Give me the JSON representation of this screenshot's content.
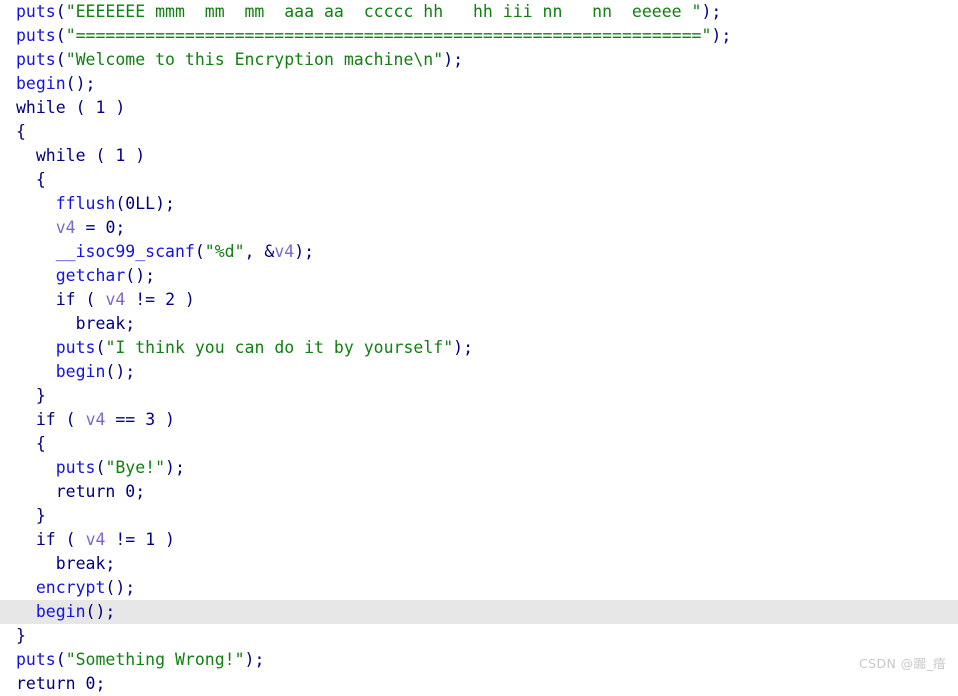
{
  "editor": {
    "kind": "decompiler-pseudocode-view",
    "background_color": "#ffffff",
    "highlight_color": "#e7e7e7",
    "token_colors": {
      "keyword": "#000080",
      "function": "#1414e0",
      "string": "#108010",
      "variable": "#7b68c8",
      "punctuation": "#000080",
      "number": "#000080"
    },
    "highlighted_line_index": 24
  },
  "watermark": {
    "text": "CSDN @嚻_瘖",
    "color": "#c8c8c8"
  },
  "code": {
    "lines": [
      {
        "indent": 0,
        "highlighted": false,
        "text": "puts(\"EEEEEEE mmm  mm  mm  aaa aa  ccccc hh   hh iii nn   nn  eeeee \");",
        "tokens": [
          {
            "c": "fn",
            "t": "puts"
          },
          {
            "c": "punct",
            "t": "("
          },
          {
            "c": "str",
            "t": "\"EEEEEEE mmm  mm  mm  aaa aa  ccccc hh   hh iii nn   nn  eeeee \""
          },
          {
            "c": "punct",
            "t": ")"
          },
          {
            "c": "plain",
            "t": ";"
          }
        ]
      },
      {
        "indent": 0,
        "highlighted": false,
        "text": "puts(\"===============================================================\");",
        "tokens": [
          {
            "c": "fn",
            "t": "puts"
          },
          {
            "c": "punct",
            "t": "("
          },
          {
            "c": "str",
            "t": "\"===============================================================\""
          },
          {
            "c": "punct",
            "t": ")"
          },
          {
            "c": "plain",
            "t": ";"
          }
        ]
      },
      {
        "indent": 0,
        "highlighted": false,
        "text": "puts(\"Welcome to this Encryption machine\\n\");",
        "tokens": [
          {
            "c": "fn",
            "t": "puts"
          },
          {
            "c": "punct",
            "t": "("
          },
          {
            "c": "str",
            "t": "\"Welcome to this Encryption machine\\n\""
          },
          {
            "c": "punct",
            "t": ")"
          },
          {
            "c": "plain",
            "t": ";"
          }
        ]
      },
      {
        "indent": 0,
        "highlighted": false,
        "text": "begin();",
        "tokens": [
          {
            "c": "fn",
            "t": "begin"
          },
          {
            "c": "punct",
            "t": "()"
          },
          {
            "c": "plain",
            "t": ";"
          }
        ]
      },
      {
        "indent": 0,
        "highlighted": false,
        "text": "while ( 1 )",
        "tokens": [
          {
            "c": "kw",
            "t": "while"
          },
          {
            "c": "plain",
            "t": " ( "
          },
          {
            "c": "num",
            "t": "1"
          },
          {
            "c": "plain",
            "t": " )"
          }
        ]
      },
      {
        "indent": 0,
        "highlighted": false,
        "text": "{",
        "tokens": [
          {
            "c": "punct",
            "t": "{"
          }
        ]
      },
      {
        "indent": 1,
        "highlighted": false,
        "text": "while ( 1 )",
        "tokens": [
          {
            "c": "kw",
            "t": "while"
          },
          {
            "c": "plain",
            "t": " ( "
          },
          {
            "c": "num",
            "t": "1"
          },
          {
            "c": "plain",
            "t": " )"
          }
        ]
      },
      {
        "indent": 1,
        "highlighted": false,
        "text": "{",
        "tokens": [
          {
            "c": "punct",
            "t": "{"
          }
        ]
      },
      {
        "indent": 2,
        "highlighted": false,
        "text": "fflush(0LL);",
        "tokens": [
          {
            "c": "fn",
            "t": "fflush"
          },
          {
            "c": "punct",
            "t": "("
          },
          {
            "c": "num",
            "t": "0LL"
          },
          {
            "c": "punct",
            "t": ")"
          },
          {
            "c": "plain",
            "t": ";"
          }
        ]
      },
      {
        "indent": 2,
        "highlighted": false,
        "text": "v4 = 0;",
        "tokens": [
          {
            "c": "var",
            "t": "v4"
          },
          {
            "c": "plain",
            "t": " = "
          },
          {
            "c": "num",
            "t": "0"
          },
          {
            "c": "plain",
            "t": ";"
          }
        ]
      },
      {
        "indent": 2,
        "highlighted": false,
        "text": "__isoc99_scanf(\"%d\", &v4);",
        "tokens": [
          {
            "c": "fn",
            "t": "__isoc99_scanf"
          },
          {
            "c": "punct",
            "t": "("
          },
          {
            "c": "str",
            "t": "\"%d\""
          },
          {
            "c": "plain",
            "t": ", &"
          },
          {
            "c": "var",
            "t": "v4"
          },
          {
            "c": "punct",
            "t": ")"
          },
          {
            "c": "plain",
            "t": ";"
          }
        ]
      },
      {
        "indent": 2,
        "highlighted": false,
        "text": "getchar();",
        "tokens": [
          {
            "c": "fn",
            "t": "getchar"
          },
          {
            "c": "punct",
            "t": "()"
          },
          {
            "c": "plain",
            "t": ";"
          }
        ]
      },
      {
        "indent": 2,
        "highlighted": false,
        "text": "if ( v4 != 2 )",
        "tokens": [
          {
            "c": "kw",
            "t": "if"
          },
          {
            "c": "plain",
            "t": " ( "
          },
          {
            "c": "var",
            "t": "v4"
          },
          {
            "c": "plain",
            "t": " != "
          },
          {
            "c": "num",
            "t": "2"
          },
          {
            "c": "plain",
            "t": " )"
          }
        ]
      },
      {
        "indent": 3,
        "highlighted": false,
        "text": "break;",
        "tokens": [
          {
            "c": "kw",
            "t": "break"
          },
          {
            "c": "plain",
            "t": ";"
          }
        ]
      },
      {
        "indent": 2,
        "highlighted": false,
        "text": "puts(\"I think you can do it by yourself\");",
        "tokens": [
          {
            "c": "fn",
            "t": "puts"
          },
          {
            "c": "punct",
            "t": "("
          },
          {
            "c": "str",
            "t": "\"I think you can do it by yourself\""
          },
          {
            "c": "punct",
            "t": ")"
          },
          {
            "c": "plain",
            "t": ";"
          }
        ]
      },
      {
        "indent": 2,
        "highlighted": false,
        "text": "begin();",
        "tokens": [
          {
            "c": "fn",
            "t": "begin"
          },
          {
            "c": "punct",
            "t": "()"
          },
          {
            "c": "plain",
            "t": ";"
          }
        ]
      },
      {
        "indent": 1,
        "highlighted": false,
        "text": "}",
        "tokens": [
          {
            "c": "punct",
            "t": "}"
          }
        ]
      },
      {
        "indent": 1,
        "highlighted": false,
        "text": "if ( v4 == 3 )",
        "tokens": [
          {
            "c": "kw",
            "t": "if"
          },
          {
            "c": "plain",
            "t": " ( "
          },
          {
            "c": "var",
            "t": "v4"
          },
          {
            "c": "plain",
            "t": " == "
          },
          {
            "c": "num",
            "t": "3"
          },
          {
            "c": "plain",
            "t": " )"
          }
        ]
      },
      {
        "indent": 1,
        "highlighted": false,
        "text": "{",
        "tokens": [
          {
            "c": "punct",
            "t": "{"
          }
        ]
      },
      {
        "indent": 2,
        "highlighted": false,
        "text": "puts(\"Bye!\");",
        "tokens": [
          {
            "c": "fn",
            "t": "puts"
          },
          {
            "c": "punct",
            "t": "("
          },
          {
            "c": "str",
            "t": "\"Bye!\""
          },
          {
            "c": "punct",
            "t": ")"
          },
          {
            "c": "plain",
            "t": ";"
          }
        ]
      },
      {
        "indent": 2,
        "highlighted": false,
        "text": "return 0;",
        "tokens": [
          {
            "c": "kw",
            "t": "return"
          },
          {
            "c": "plain",
            "t": " "
          },
          {
            "c": "num",
            "t": "0"
          },
          {
            "c": "plain",
            "t": ";"
          }
        ]
      },
      {
        "indent": 1,
        "highlighted": false,
        "text": "}",
        "tokens": [
          {
            "c": "punct",
            "t": "}"
          }
        ]
      },
      {
        "indent": 1,
        "highlighted": false,
        "text": "if ( v4 != 1 )",
        "tokens": [
          {
            "c": "kw",
            "t": "if"
          },
          {
            "c": "plain",
            "t": " ( "
          },
          {
            "c": "var",
            "t": "v4"
          },
          {
            "c": "plain",
            "t": " != "
          },
          {
            "c": "num",
            "t": "1"
          },
          {
            "c": "plain",
            "t": " )"
          }
        ]
      },
      {
        "indent": 2,
        "highlighted": false,
        "text": "break;",
        "tokens": [
          {
            "c": "kw",
            "t": "break"
          },
          {
            "c": "plain",
            "t": ";"
          }
        ]
      },
      {
        "indent": 1,
        "highlighted": false,
        "text": "encrypt();",
        "tokens": [
          {
            "c": "fn",
            "t": "encrypt"
          },
          {
            "c": "punct",
            "t": "()"
          },
          {
            "c": "plain",
            "t": ";"
          }
        ]
      },
      {
        "indent": 1,
        "highlighted": true,
        "text": "begin();",
        "tokens": [
          {
            "c": "fn",
            "t": "begin"
          },
          {
            "c": "punct",
            "t": "()"
          },
          {
            "c": "plain",
            "t": ";"
          }
        ]
      },
      {
        "indent": 0,
        "highlighted": false,
        "text": "}",
        "tokens": [
          {
            "c": "punct",
            "t": "}"
          }
        ]
      },
      {
        "indent": 0,
        "highlighted": false,
        "text": "puts(\"Something Wrong!\");",
        "tokens": [
          {
            "c": "fn",
            "t": "puts"
          },
          {
            "c": "punct",
            "t": "("
          },
          {
            "c": "str",
            "t": "\"Something Wrong!\""
          },
          {
            "c": "punct",
            "t": ")"
          },
          {
            "c": "plain",
            "t": ";"
          }
        ]
      },
      {
        "indent": 0,
        "highlighted": false,
        "text": "return 0;",
        "tokens": [
          {
            "c": "kw",
            "t": "return"
          },
          {
            "c": "plain",
            "t": " "
          },
          {
            "c": "num",
            "t": "0"
          },
          {
            "c": "plain",
            "t": ";"
          }
        ]
      }
    ]
  }
}
